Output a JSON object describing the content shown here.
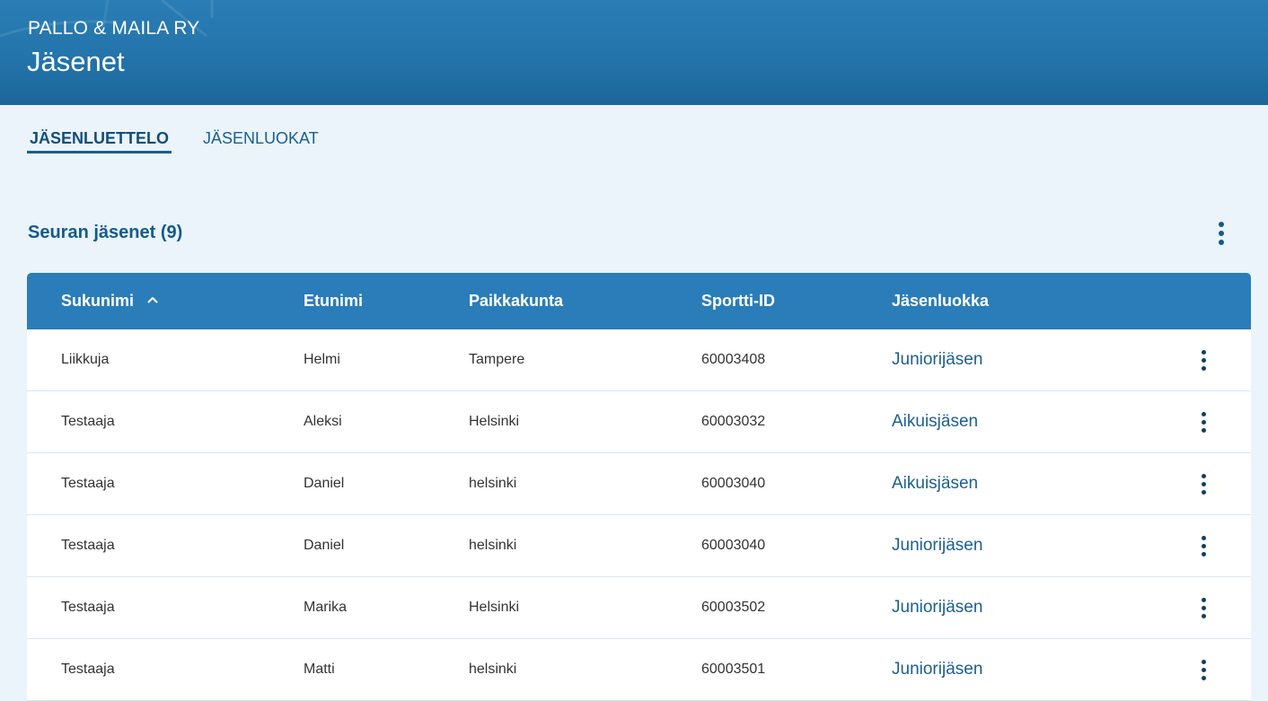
{
  "header": {
    "org_name": "PALLO & MAILA RY",
    "page_title": "Jäsenet"
  },
  "tabs": [
    {
      "label": "JÄSENLUETTELO",
      "active": true
    },
    {
      "label": "JÄSENLUOKAT",
      "active": false
    }
  ],
  "section": {
    "title": "Seuran jäsenet (9)",
    "menu_icon": "more-vertical-icon"
  },
  "table": {
    "columns": [
      "Sukunimi",
      "Etunimi",
      "Paikkakunta",
      "Sportti-ID",
      "Jäsenluokka"
    ],
    "sort": {
      "column": "Sukunimi",
      "direction": "ascending",
      "icon": "chevron-up-icon"
    },
    "row_menu_icon": "more-vertical-icon",
    "rows": [
      {
        "sukunimi": "Liikkuja",
        "etunimi": "Helmi",
        "paikkakunta": "Tampere",
        "sportti_id": "60003408",
        "jasenluokka": "Juniorijäsen"
      },
      {
        "sukunimi": "Testaaja",
        "etunimi": "Aleksi",
        "paikkakunta": "Helsinki",
        "sportti_id": "60003032",
        "jasenluokka": "Aikuisjäsen"
      },
      {
        "sukunimi": "Testaaja",
        "etunimi": "Daniel",
        "paikkakunta": "helsinki",
        "sportti_id": "60003040",
        "jasenluokka": "Aikuisjäsen"
      },
      {
        "sukunimi": "Testaaja",
        "etunimi": "Daniel",
        "paikkakunta": "helsinki",
        "sportti_id": "60003040",
        "jasenluokka": "Juniorijäsen"
      },
      {
        "sukunimi": "Testaaja",
        "etunimi": "Marika",
        "paikkakunta": "Helsinki",
        "sportti_id": "60003502",
        "jasenluokka": "Juniorijäsen"
      },
      {
        "sukunimi": "Testaaja",
        "etunimi": "Matti",
        "paikkakunta": "helsinki",
        "sportti_id": "60003501",
        "jasenluokka": "Juniorijäsen"
      }
    ]
  },
  "colors": {
    "header_bg": "#2374ab",
    "table_header_bg": "#2a7db8",
    "page_bg": "#eaf4fa",
    "accent": "#1a5f91"
  }
}
